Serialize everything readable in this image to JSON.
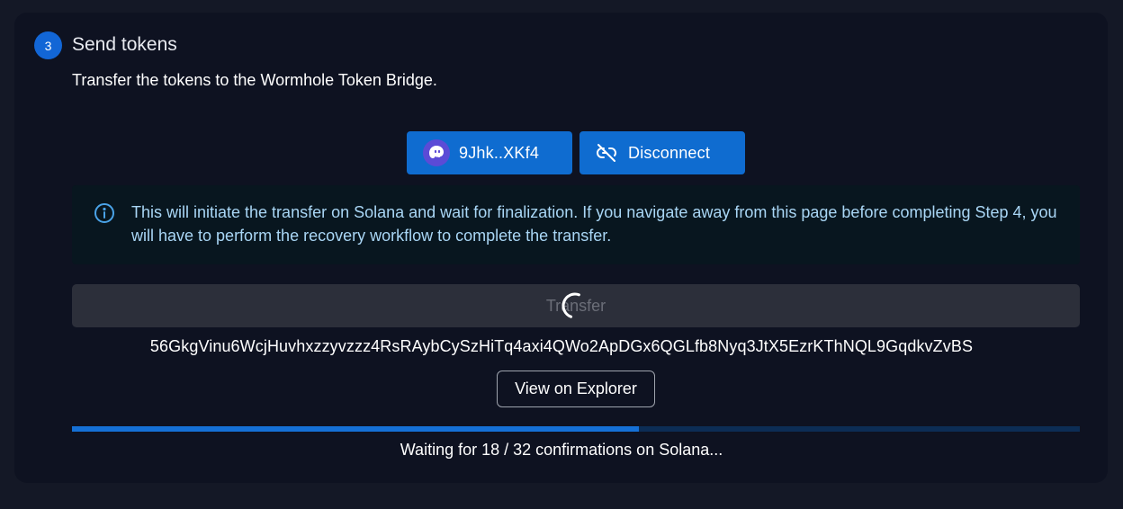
{
  "step": {
    "number": "3",
    "title": "Send tokens",
    "description": "Transfer the tokens to the Wormhole Token Bridge."
  },
  "wallet": {
    "address_short": "9Jhk..XKf4",
    "avatar_icon": "ghost-icon",
    "disconnect_label": "Disconnect",
    "disconnect_icon": "unlink-icon"
  },
  "info": {
    "icon": "info-icon",
    "text": "This will initiate the transfer on Solana and wait for finalization. If you navigate away from this page before completing Step 4, you will have to perform the recovery workflow to complete the transfer."
  },
  "transfer": {
    "label": "Transfer",
    "loading": true
  },
  "transaction": {
    "hash": "56GkgVinu6WcjHuvhxzzyvzzz4RsRAybCySzHiTq4axi4QWo2ApDGx6QGLfb8Nyq3JtX5EzrKThNQL9GqdkvZvBS",
    "explorer_label": "View on Explorer"
  },
  "confirmations": {
    "current": 18,
    "required": 32,
    "status_text": "Waiting for 18 / 32 confirmations on Solana..."
  },
  "colors": {
    "accent": "#0f6cd0",
    "background": "#0e1221",
    "info_text": "#a9d6f5",
    "progress_track": "#0c2d55"
  }
}
